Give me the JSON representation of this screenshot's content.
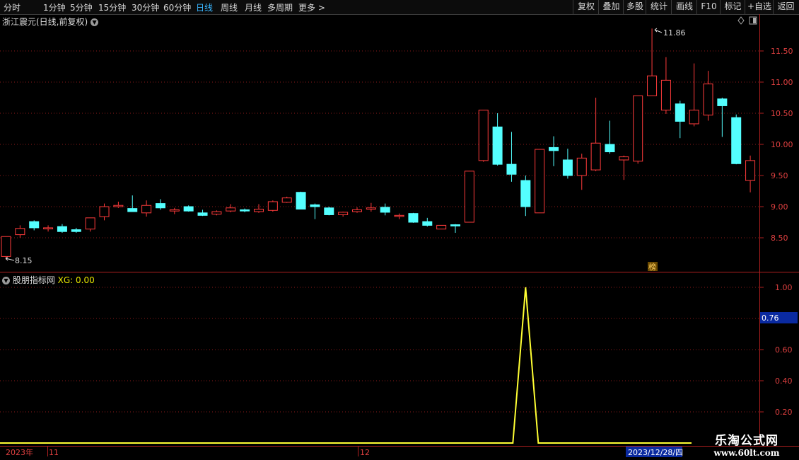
{
  "toolbar": {
    "periods": [
      "分时",
      "1分钟",
      "5分钟",
      "15分钟",
      "30分钟",
      "60分钟",
      "日线",
      "周线",
      "月线",
      "多周期",
      "更多 >"
    ],
    "active": "日线",
    "right_buttons": [
      "复权",
      "叠加",
      "多股",
      "统计",
      "画线",
      "F10",
      "标记",
      "+自选",
      "返回"
    ]
  },
  "stock": {
    "title": "浙江震元(日线,前复权)"
  },
  "indicator": {
    "name": "股朋指标网",
    "xg_label": "XG: 0.00",
    "cursor_value": "0.76"
  },
  "badge": "榜",
  "date_axis": {
    "labels": [
      "2023年",
      "11",
      "12"
    ],
    "cursor_date": "2023/12/28/四"
  },
  "watermark": {
    "line1": "乐淘公式网",
    "line2": "www.60lt.com"
  },
  "colors": {
    "up": "#ff3b3b",
    "down": "#54ffff",
    "line": "#ffff33",
    "grid": "#8b1a1a"
  },
  "chart_data": [
    {
      "type": "candlestick",
      "y_ticks": [
        "11.50",
        "11.00",
        "10.50",
        "10.00",
        "9.50",
        "9.00",
        "8.50"
      ],
      "high_label": "11.86",
      "low_label": "8.15",
      "ohlc": [
        [
          8.2,
          8.52,
          8.15,
          8.52
        ],
        [
          8.55,
          8.7,
          8.5,
          8.65
        ],
        [
          8.76,
          8.78,
          8.62,
          8.66
        ],
        [
          8.65,
          8.7,
          8.6,
          8.66
        ],
        [
          8.68,
          8.72,
          8.58,
          8.6
        ],
        [
          8.63,
          8.66,
          8.58,
          8.6
        ],
        [
          8.64,
          8.82,
          8.6,
          8.82
        ],
        [
          8.84,
          9.05,
          8.78,
          9.0
        ],
        [
          9.0,
          9.08,
          8.98,
          9.02
        ],
        [
          8.97,
          9.18,
          8.93,
          8.92
        ],
        [
          8.9,
          9.1,
          8.84,
          9.02
        ],
        [
          9.05,
          9.12,
          8.95,
          8.98
        ],
        [
          8.93,
          8.98,
          8.88,
          8.95
        ],
        [
          9.0,
          9.02,
          8.92,
          8.93
        ],
        [
          8.9,
          8.95,
          8.85,
          8.86
        ],
        [
          8.88,
          8.94,
          8.86,
          8.92
        ],
        [
          8.93,
          9.04,
          8.91,
          8.98
        ],
        [
          8.95,
          8.97,
          8.91,
          8.93
        ],
        [
          8.92,
          9.04,
          8.9,
          8.96
        ],
        [
          8.94,
          9.1,
          8.92,
          9.08
        ],
        [
          9.07,
          9.16,
          9.06,
          9.14
        ],
        [
          9.23,
          9.24,
          8.96,
          8.96
        ],
        [
          9.03,
          9.05,
          8.8,
          9.0
        ],
        [
          8.98,
          9.0,
          8.86,
          8.87
        ],
        [
          8.87,
          8.92,
          8.84,
          8.91
        ],
        [
          8.92,
          8.99,
          8.9,
          8.95
        ],
        [
          8.96,
          9.06,
          8.92,
          8.98
        ],
        [
          8.99,
          9.05,
          8.86,
          8.91
        ],
        [
          8.85,
          8.89,
          8.8,
          8.86
        ],
        [
          8.89,
          8.9,
          8.74,
          8.75
        ],
        [
          8.76,
          8.82,
          8.68,
          8.7
        ],
        [
          8.64,
          8.7,
          8.64,
          8.7
        ],
        [
          8.71,
          8.72,
          8.58,
          8.69
        ],
        [
          8.75,
          9.57,
          8.75,
          9.57
        ],
        [
          9.74,
          10.55,
          9.72,
          10.55
        ],
        [
          10.28,
          10.5,
          9.66,
          9.68
        ],
        [
          9.68,
          10.2,
          9.4,
          9.52
        ],
        [
          9.42,
          9.5,
          8.85,
          9.0
        ],
        [
          8.9,
          9.92,
          8.9,
          9.92
        ],
        [
          9.95,
          10.13,
          9.65,
          9.9
        ],
        [
          9.75,
          9.93,
          9.45,
          9.5
        ],
        [
          9.5,
          9.85,
          9.27,
          9.78
        ],
        [
          9.59,
          10.75,
          9.57,
          10.02
        ],
        [
          10.0,
          10.38,
          9.85,
          9.88
        ],
        [
          9.75,
          9.82,
          9.43,
          9.8
        ],
        [
          9.73,
          10.78,
          9.69,
          10.78
        ],
        [
          10.78,
          11.86,
          10.78,
          11.1
        ],
        [
          10.55,
          11.4,
          10.49,
          11.03
        ],
        [
          10.65,
          10.7,
          10.1,
          10.37
        ],
        [
          10.33,
          11.3,
          10.29,
          10.55
        ],
        [
          10.47,
          11.18,
          10.38,
          10.97
        ],
        [
          10.73,
          10.75,
          10.12,
          10.62
        ],
        [
          10.43,
          10.48,
          9.68,
          9.69
        ],
        [
          9.42,
          9.82,
          9.23,
          9.74
        ]
      ]
    },
    {
      "type": "line",
      "name": "XG",
      "y_ticks": [
        "1.00",
        "0.80",
        "0.60",
        "0.40",
        "0.20"
      ],
      "ylim": [
        0,
        1
      ],
      "values": [
        0,
        0,
        0,
        0,
        0,
        0,
        0,
        0,
        0,
        0,
        0,
        0,
        0,
        0,
        0,
        0,
        0,
        0,
        0,
        0,
        0,
        0,
        0,
        0,
        0,
        0,
        0,
        0,
        0,
        0,
        0,
        0,
        0,
        0,
        0,
        0,
        0,
        1,
        0,
        0,
        0,
        0,
        0,
        0,
        0,
        0,
        0,
        0,
        0,
        0,
        0,
        0,
        0,
        0
      ]
    }
  ]
}
